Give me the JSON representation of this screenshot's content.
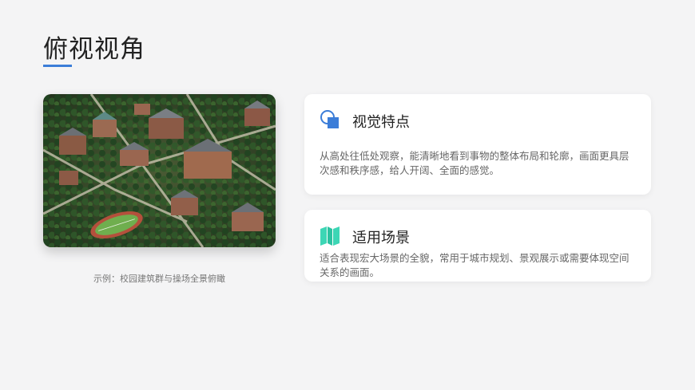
{
  "slide": {
    "title": "俯视视角",
    "accent_color": "#3b7dd8"
  },
  "image": {
    "icon": "aerial-campus-photo",
    "caption": "示例：校园建筑群与操场全景俯瞰"
  },
  "cards": [
    {
      "icon": "overlapping-shapes-icon",
      "icon_color": "#3b7dd8",
      "heading": "视觉特点",
      "body": "从高处往低处观察，能清晰地看到事物的整体布局和轮廓，画面更具层次感和秩序感，给人开阔、全面的感觉。"
    },
    {
      "icon": "folded-map-icon",
      "icon_color": "#3dd6b5",
      "heading": "适用场景",
      "body": "适合表现宏大场景的全貌，常用于城市规划、景观展示或需要体现空间关系的画面。"
    }
  ]
}
